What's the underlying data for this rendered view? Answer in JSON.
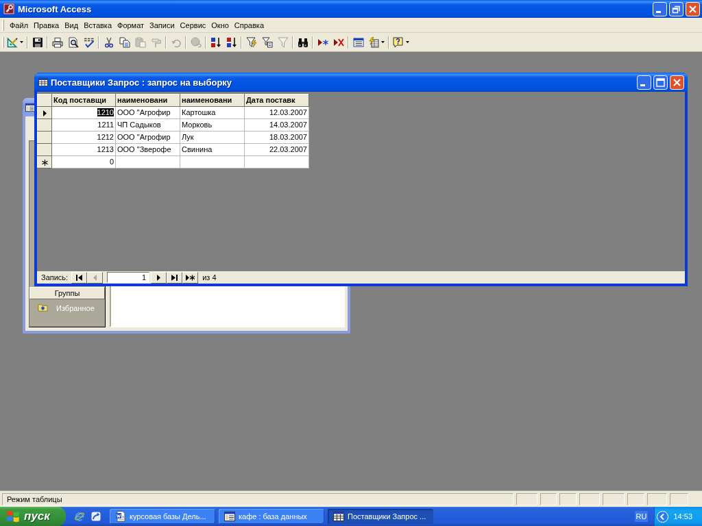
{
  "window": {
    "title": "Microsoft Access"
  },
  "menu": [
    "Файл",
    "Правка",
    "Вид",
    "Вставка",
    "Формат",
    "Записи",
    "Сервис",
    "Окно",
    "Справка"
  ],
  "toolbar": [
    {
      "buttons": [
        {
          "kind": "design-view",
          "disabled": false,
          "dropdown": true
        }
      ]
    },
    {
      "buttons": [
        {
          "kind": "save",
          "disabled": false,
          "dropdown": false
        }
      ]
    },
    {
      "buttons": [
        {
          "kind": "print",
          "disabled": false,
          "dropdown": false
        },
        {
          "kind": "print-preview",
          "disabled": false,
          "dropdown": false
        },
        {
          "kind": "spelling",
          "disabled": false,
          "dropdown": false
        }
      ]
    },
    {
      "buttons": [
        {
          "kind": "cut",
          "disabled": false,
          "dropdown": false
        },
        {
          "kind": "copy",
          "disabled": false,
          "dropdown": false
        },
        {
          "kind": "paste",
          "disabled": true,
          "dropdown": false
        },
        {
          "kind": "format-painter",
          "disabled": true,
          "dropdown": false
        }
      ]
    },
    {
      "buttons": [
        {
          "kind": "undo",
          "disabled": true,
          "dropdown": false
        }
      ]
    },
    {
      "buttons": [
        {
          "kind": "hyperlink",
          "disabled": true,
          "dropdown": false
        }
      ]
    },
    {
      "buttons": [
        {
          "kind": "sort-ascending",
          "disabled": false,
          "dropdown": false
        },
        {
          "kind": "sort-descending",
          "disabled": false,
          "dropdown": false
        }
      ]
    },
    {
      "buttons": [
        {
          "kind": "filter-by-selection",
          "disabled": false,
          "dropdown": false
        },
        {
          "kind": "filter-by-form",
          "disabled": false,
          "dropdown": false
        },
        {
          "kind": "apply-filter",
          "disabled": true,
          "dropdown": false
        }
      ]
    },
    {
      "buttons": [
        {
          "kind": "find",
          "disabled": false,
          "dropdown": false
        }
      ]
    },
    {
      "buttons": [
        {
          "kind": "new-record",
          "disabled": false,
          "dropdown": false
        },
        {
          "kind": "delete-record",
          "disabled": false,
          "dropdown": false
        }
      ]
    },
    {
      "buttons": [
        {
          "kind": "database-window",
          "disabled": false,
          "dropdown": false
        },
        {
          "kind": "new-object",
          "disabled": false,
          "dropdown": true
        }
      ]
    },
    {
      "buttons": [
        {
          "kind": "help",
          "disabled": false,
          "dropdown": true
        }
      ]
    }
  ],
  "database_window": {
    "groups_button": "Группы",
    "favorites": "Избранное"
  },
  "query_window": {
    "title": "Поставщики Запрос : запрос на выборку",
    "columns": [
      {
        "label": "Код поставщи",
        "kind": "number"
      },
      {
        "label": "наименовани",
        "kind": "text"
      },
      {
        "label": "наименовани",
        "kind": "text"
      },
      {
        "label": "Дата поставк",
        "kind": "date"
      }
    ],
    "rows": [
      {
        "current": true,
        "cells": [
          {
            "text": "1210",
            "selected": true
          },
          {
            "text": "ООО \"Агрофир",
            "selected": false
          },
          {
            "text": "Картошка",
            "selected": false
          },
          {
            "text": "12.03.2007",
            "selected": false
          }
        ]
      },
      {
        "current": false,
        "cells": [
          {
            "text": "1211",
            "selected": false
          },
          {
            "text": "ЧП Садыков",
            "selected": false
          },
          {
            "text": "Морковь",
            "selected": false
          },
          {
            "text": "14.03.2007",
            "selected": false
          }
        ]
      },
      {
        "current": false,
        "cells": [
          {
            "text": "1212",
            "selected": false
          },
          {
            "text": "ООО \"Агрофир",
            "selected": false
          },
          {
            "text": "Лук",
            "selected": false
          },
          {
            "text": "18.03.2007",
            "selected": false
          }
        ]
      },
      {
        "current": false,
        "cells": [
          {
            "text": "1213",
            "selected": false
          },
          {
            "text": "ООО \"Зверофе",
            "selected": false
          },
          {
            "text": "Свинина",
            "selected": false
          },
          {
            "text": "22.03.2007",
            "selected": false
          }
        ]
      }
    ],
    "new_record": {
      "values": [
        "0"
      ]
    },
    "navigator": {
      "label": "Запись:",
      "current": "1",
      "count": "из 4",
      "buttons_before": [
        {
          "kind": "first",
          "disabled": false
        },
        {
          "kind": "previous",
          "disabled": true
        }
      ],
      "buttons_after": [
        {
          "kind": "next",
          "disabled": false
        },
        {
          "kind": "last",
          "disabled": false
        },
        {
          "kind": "new",
          "disabled": false
        }
      ]
    }
  },
  "status_bar": {
    "text": "Режим таблицы"
  },
  "taskbar": {
    "start_label": "пуск",
    "quick_launch": [
      {
        "kind": "browser"
      },
      {
        "kind": "arrow-tile"
      }
    ],
    "tasks": [
      {
        "kind": "document",
        "label": "курсовая базы Дель...",
        "selected": false
      },
      {
        "kind": "database",
        "label": "кафе : база данных",
        "selected": false
      },
      {
        "kind": "datasheet",
        "label": "Поставщики Запрос ...",
        "selected": true
      }
    ],
    "language": "RU",
    "clock": "14:53"
  }
}
